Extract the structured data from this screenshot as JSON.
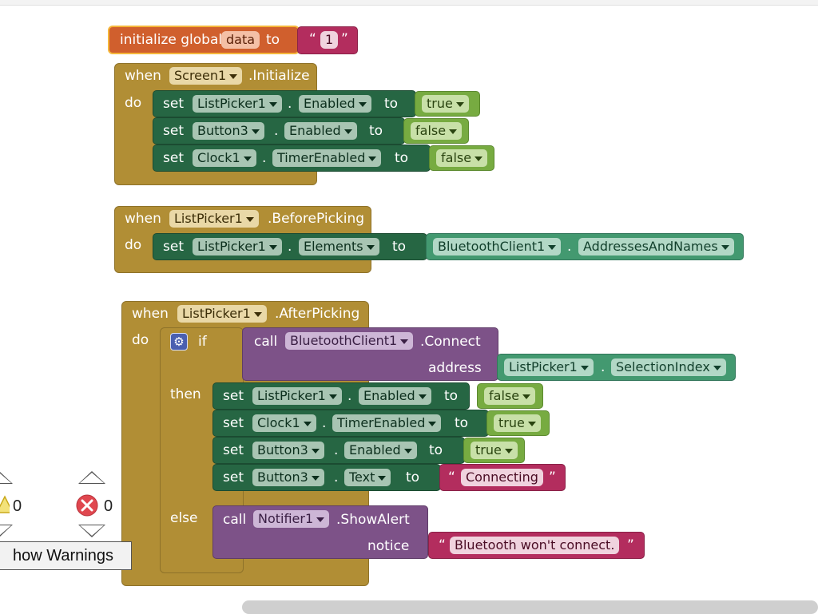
{
  "workspace": {
    "global_var": {
      "prefix": "initialize global",
      "name": "data",
      "to_label": "to",
      "value": "1"
    },
    "event_screen_init": {
      "when": "when",
      "component": "Screen1",
      "event": ".Initialize",
      "do": "do",
      "statements": [
        {
          "set": "set",
          "component": "ListPicker1",
          "property": "Enabled",
          "to": "to",
          "value": "true"
        },
        {
          "set": "set",
          "component": "Button3",
          "property": "Enabled",
          "to": "to",
          "value": "false"
        },
        {
          "set": "set",
          "component": "Clock1",
          "property": "TimerEnabled",
          "to": "to",
          "value": "false"
        }
      ]
    },
    "event_before_picking": {
      "when": "when",
      "component": "ListPicker1",
      "event": ".BeforePicking",
      "do": "do",
      "statement": {
        "set": "set",
        "component": "ListPicker1",
        "property": "Elements",
        "to": "to",
        "value_component": "BluetoothClient1",
        "value_property": "AddressesAndNames"
      }
    },
    "event_after_picking": {
      "when": "when",
      "component": "ListPicker1",
      "event": ".AfterPicking",
      "do": "do",
      "if_label": "if",
      "then_label": "then",
      "else_label": "else",
      "condition": {
        "call": "call",
        "component": "BluetoothClient1",
        "method": ".Connect",
        "arg_label": "address",
        "arg_component": "ListPicker1",
        "arg_property": "SelectionIndex"
      },
      "then_statements": [
        {
          "set": "set",
          "component": "ListPicker1",
          "property": "Enabled",
          "to": "to",
          "value": "false"
        },
        {
          "set": "set",
          "component": "Clock1",
          "property": "TimerEnabled",
          "to": "to",
          "value": "true"
        },
        {
          "set": "set",
          "component": "Button3",
          "property": "Enabled",
          "to": "to",
          "value": "true"
        },
        {
          "set": "set",
          "component": "Button3",
          "property": "Text",
          "to": "to",
          "value": "Connecting"
        }
      ],
      "else_call": {
        "call": "call",
        "component": "Notifier1",
        "method": ".ShowAlert",
        "arg_label": "notice",
        "value": "Bluetooth won't connect."
      }
    },
    "dot": ".",
    "quote_open": "“",
    "quote_close": "”"
  },
  "warnings": {
    "warning_count": "0",
    "error_count": "0",
    "show_warnings_label": "how Warnings"
  },
  "icons": {
    "gear": "gear-icon",
    "warning": "warning-triangle-icon",
    "error": "error-circle-icon"
  },
  "colors": {
    "event_block": "#b18e35",
    "setter_block": "#266643",
    "logic_block": "#77ab41",
    "procedure_call": "#7d5288",
    "text_block": "#b32d5e",
    "global_var": "#d05f2d",
    "component_block": "#439970"
  }
}
